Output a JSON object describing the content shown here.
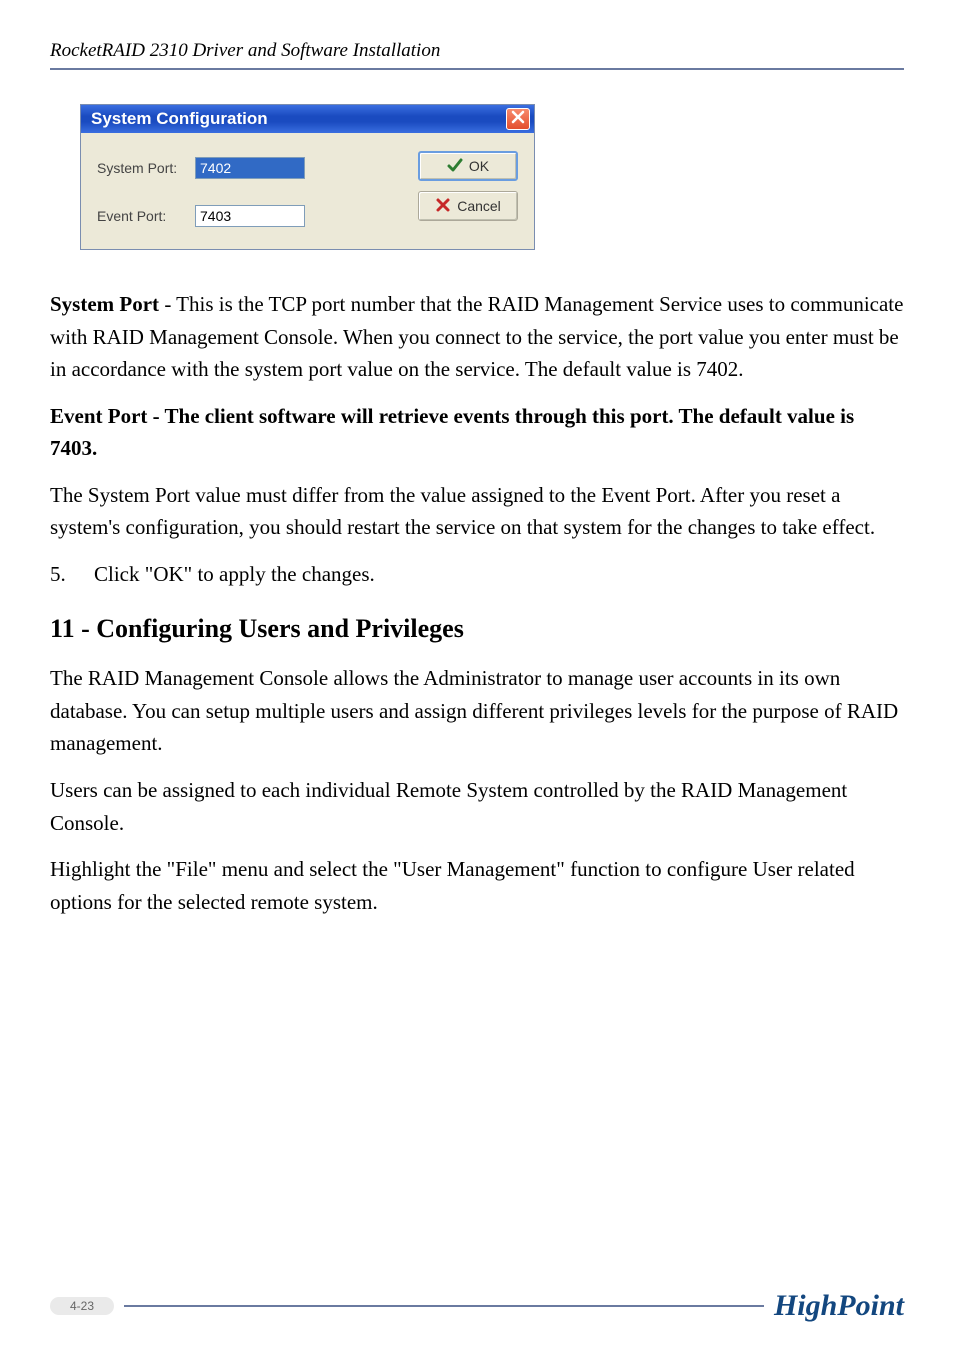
{
  "header": {
    "title": "RocketRAID 2310 Driver and Software Installation"
  },
  "dialog": {
    "title": "System Configuration",
    "system_port_label": "System Port:",
    "system_port_value": "7402",
    "event_port_label": "Event Port:",
    "event_port_value": "7403",
    "ok_label": "OK",
    "cancel_label": "Cancel"
  },
  "doc": {
    "p1_bold": "System Port",
    "p1_rest": " - This is the TCP port number that the RAID Management Service uses to communicate with RAID Management Console.  When you connect to the service, the port value you enter must be in accordance with the system port value on the service.  The default value is 7402.",
    "p2": "Event Port - The client software will retrieve events through this port.  The default value is 7403.",
    "p3": "The System Port value must differ from the value assigned to the Event Port.  After you reset a system's configuration, you should restart the service on that system for the changes to take effect.",
    "step5_num": "5.",
    "step5_text": "Click \"OK\" to apply the changes.",
    "h2": "11 - Configuring Users and Privileges",
    "p4": "The RAID Management Console allows the Administrator to manage user accounts in its own database. You can setup multiple users and assign different privileges levels for the purpose of RAID management.",
    "p5": "Users can be assigned to each individual Remote System controlled by the RAID Management Console.",
    "p6": "Highlight the \"File\" menu and select the \"User Management\" function to configure User related options for the selected remote system."
  },
  "footer": {
    "page": "4-23",
    "brand": "HighPoint"
  }
}
